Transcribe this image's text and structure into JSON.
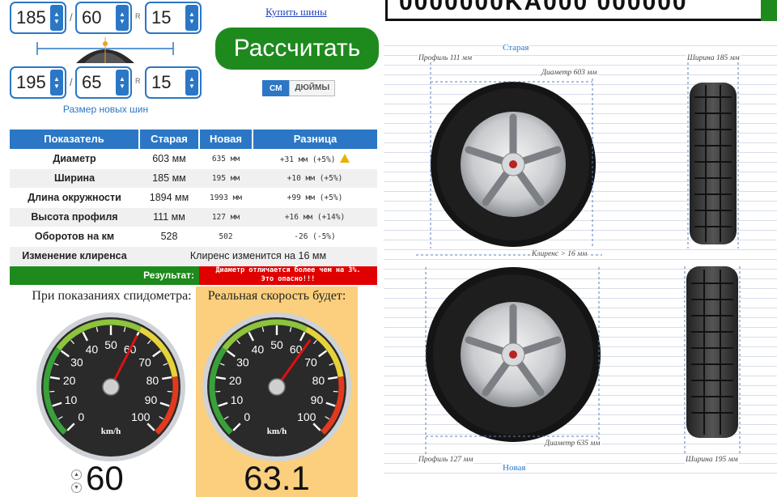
{
  "top_banner": {
    "text": "0000000KA000 000000"
  },
  "current_size": {
    "width": "185",
    "profile": "60",
    "rim": "15",
    "sep": "/",
    "r": "R"
  },
  "new_size": {
    "width": "195",
    "profile": "65",
    "rim": "15",
    "sep": "/",
    "r": "R",
    "caption": "Размер новых шин"
  },
  "buy_link": "Купить шины",
  "calc_button": "Рассчитать",
  "units": {
    "cm": "СМ",
    "inch": "ДЮЙМЫ",
    "selected": "cm"
  },
  "table": {
    "headers": [
      "Показатель",
      "Старая",
      "Новая",
      "Разница"
    ],
    "rows": [
      {
        "label": "Диаметр",
        "old": "603 мм",
        "new": "635 мм",
        "diff": "+31 мм (+5%)"
      },
      {
        "label": "Ширина",
        "old": "185 мм",
        "new": "195 мм",
        "diff": "+10 мм (+5%)"
      },
      {
        "label": "Длина окружности",
        "old": "1894 мм",
        "new": "1993 мм",
        "diff": "+99 мм (+5%)"
      },
      {
        "label": "Высота профиля",
        "old": "111 мм",
        "new": "127 мм",
        "diff": "+16 мм (+14%)"
      },
      {
        "label": "Оборотов на км",
        "old": "528",
        "new": "502",
        "diff": "-26 (-5%)"
      }
    ],
    "clearance_label": "Изменение клиренса",
    "clearance_value": "Клиренс изменится на 16 мм",
    "result_label": "Результат:",
    "result_line1": "Диаметр отличается более чем на 3%.",
    "result_line2": "Это опасно!!!"
  },
  "speedo_left": {
    "caption": "При показаниях спидометра:",
    "value": "60",
    "unit": "km/h"
  },
  "speedo_right": {
    "caption": "Реальная скорость будет:",
    "value": "63.1",
    "unit": "km/h"
  },
  "gauge_labels": [
    "0",
    "10",
    "20",
    "30",
    "40",
    "50",
    "60",
    "70",
    "80",
    "90",
    "100"
  ],
  "diagram": {
    "old_title": "Старая",
    "new_title": "Новая",
    "old_profile": "Профиль 111 мм",
    "old_diameter": "Диаметр 603 мм",
    "old_width": "Ширина 185 мм",
    "clearance": "Клиренс > 16 мм",
    "new_diameter": "Диаметр 635 мм",
    "new_profile": "Профиль 127 мм",
    "new_width": "Ширина 195 мм"
  },
  "colors": {
    "accent": "#2b77c5",
    "button_green": "#1e8a1e",
    "danger": "#e10000",
    "speed_bg": "#fbcf7d"
  }
}
